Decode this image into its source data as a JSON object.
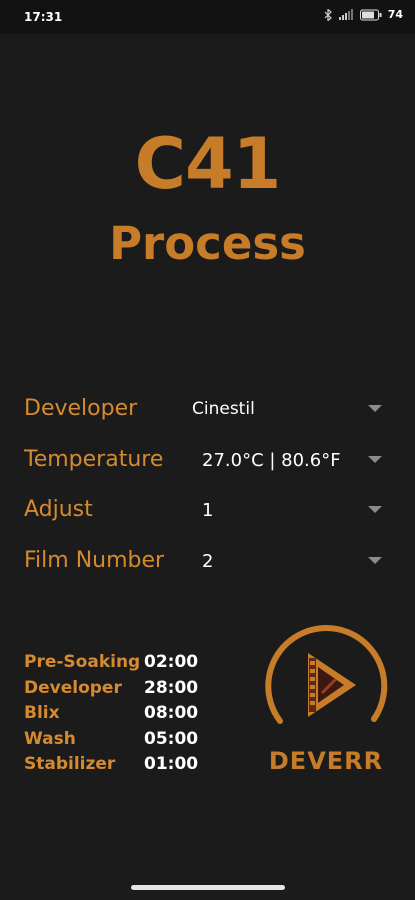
{
  "status_bar": {
    "time": "17:31",
    "battery": "74"
  },
  "header": {
    "title": "C41",
    "subtitle": "Process"
  },
  "settings": [
    {
      "label": "Developer",
      "value": "Cinestil"
    },
    {
      "label": "Temperature",
      "value": "27.0°C | 80.6°F"
    },
    {
      "label": "Adjust",
      "value": "1"
    },
    {
      "label": "Film Number",
      "value": "2"
    }
  ],
  "steps": [
    {
      "name": "Pre-Soaking",
      "time": "02:00"
    },
    {
      "name": "Developer",
      "time": "28:00"
    },
    {
      "name": "Blix",
      "time": "08:00"
    },
    {
      "name": "Wash",
      "time": "05:00"
    },
    {
      "name": "Stabilizer",
      "time": "01:00"
    }
  ],
  "logo": {
    "text": "DEVERR",
    "icon": "play-film-icon"
  },
  "colors": {
    "accent": "#c67c28",
    "background": "#1c1b1b"
  }
}
